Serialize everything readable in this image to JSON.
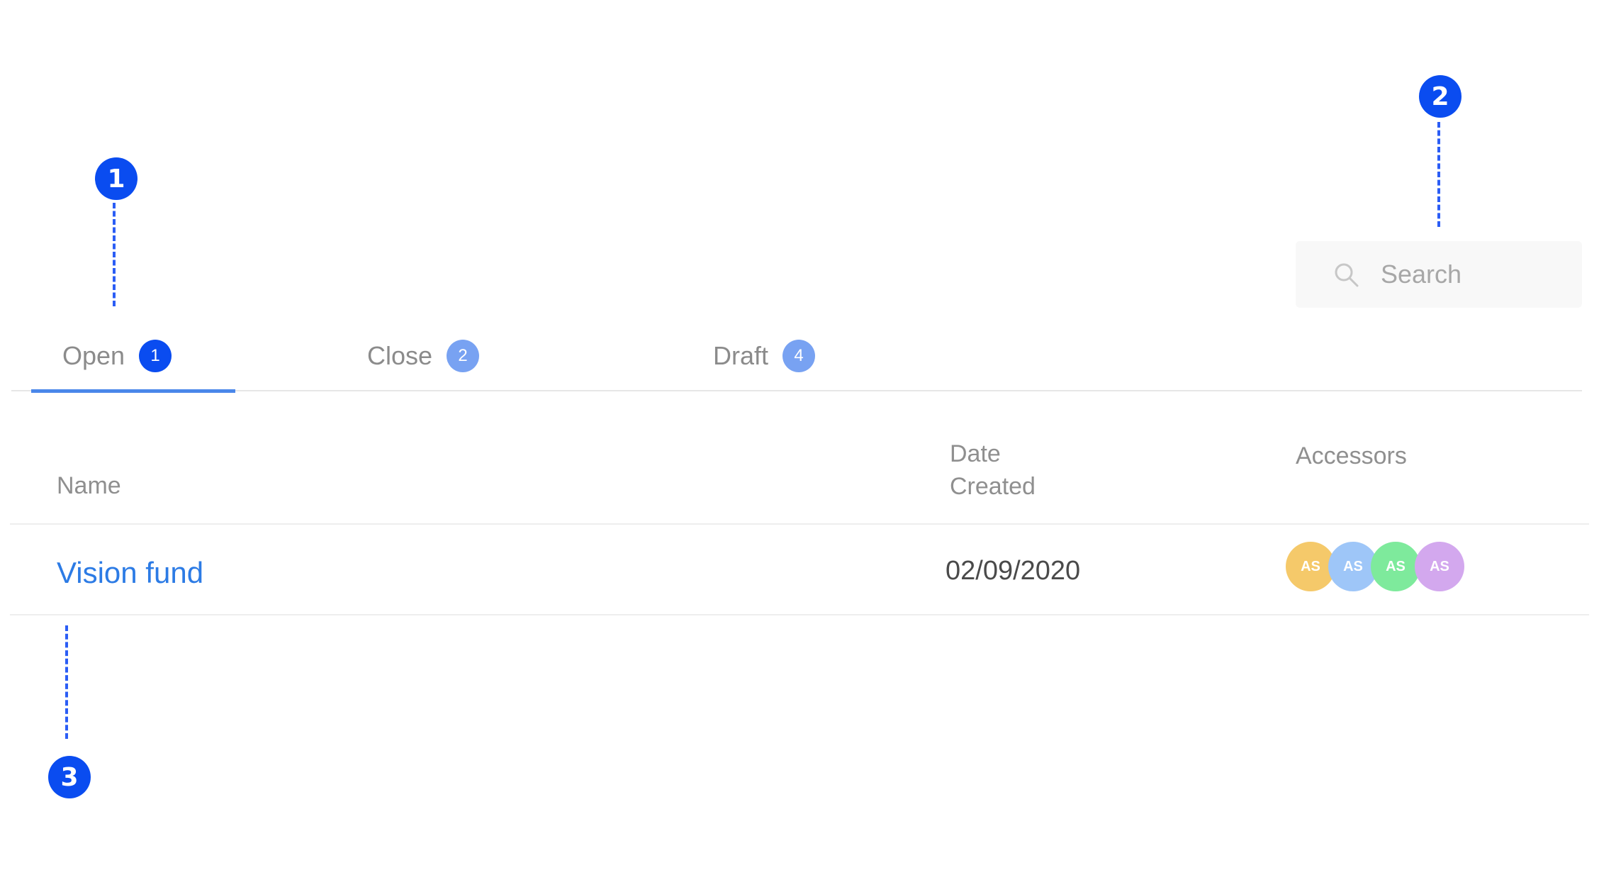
{
  "markers": [
    "1",
    "2",
    "3"
  ],
  "search": {
    "placeholder": "Search",
    "icon": "search-icon"
  },
  "tabs": [
    {
      "label": "Open",
      "count": "1",
      "active": true
    },
    {
      "label": "Close",
      "count": "2",
      "active": false
    },
    {
      "label": "Draft",
      "count": "4",
      "active": false
    }
  ],
  "table": {
    "headers": {
      "name": "Name",
      "date_line1": "Date",
      "date_line2": "Created",
      "accessors": "Accessors"
    },
    "rows": [
      {
        "name": "Vision fund",
        "date_created": "02/09/2020",
        "accessors": [
          {
            "initials": "AS",
            "color": "#f5c96a"
          },
          {
            "initials": "AS",
            "color": "#9ec6f8"
          },
          {
            "initials": "AS",
            "color": "#7eea9c"
          },
          {
            "initials": "AS",
            "color": "#d3a8ee"
          }
        ]
      }
    ]
  },
  "colors": {
    "accent": "#0a4cf0",
    "link": "#2c7be5",
    "tab_underline": "#4a87ea",
    "inactive_badge": "#78a2f2"
  }
}
